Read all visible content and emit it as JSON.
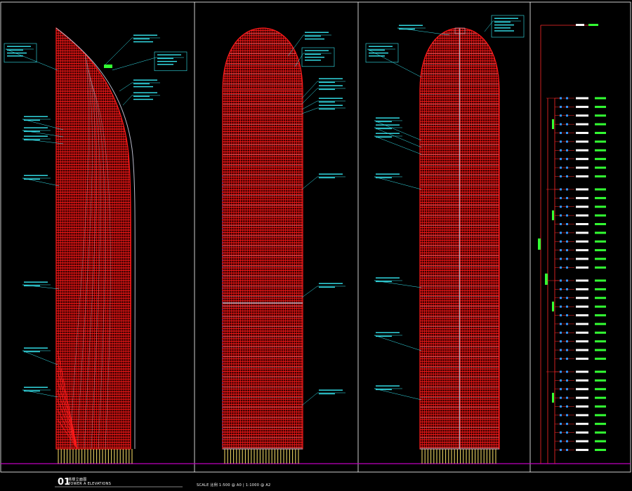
{
  "drawing": {
    "number": "01",
    "title": "塔楼立面图",
    "subtitle": "TOWER A ELEVATIONS",
    "scale": "SCALE 比例 1:500 @ A0 | 1:1000 @ A2"
  },
  "palette": {
    "background": "#000000",
    "structure": "#ff1a1a",
    "cladding": "#b8b8c8",
    "callout": "#35e6f0",
    "frame": "#ffffff",
    "ground": "#c000c0",
    "level": "#33ff33",
    "dimension": "#ff2a2a",
    "marker": "#3399ff"
  },
  "elevations": [
    {
      "id": "side-elevation",
      "profile": "blade"
    },
    {
      "id": "front-elevation",
      "profile": "bullet"
    },
    {
      "id": "rear-elevation",
      "profile": "bullet-split"
    }
  ],
  "level_schedule": {
    "zones": 4,
    "levels_per_zone": 10
  }
}
